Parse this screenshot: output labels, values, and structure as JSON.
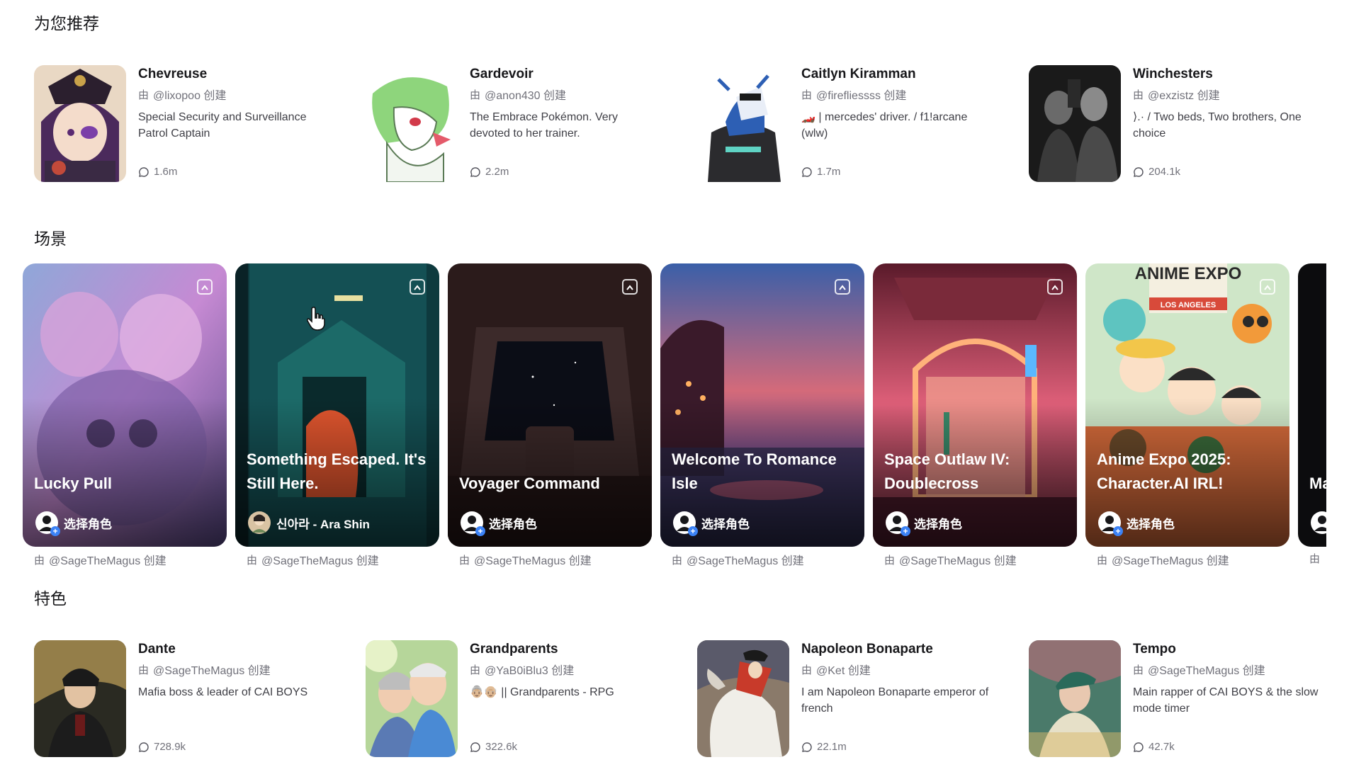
{
  "sections": {
    "recommended": "为您推荐",
    "scenes": "场景",
    "featured": "特色"
  },
  "labels": {
    "creator_glyph": "由",
    "created_suffix": "创建",
    "pick_role": "选择角色"
  },
  "recommended": [
    {
      "name": "Chevreuse",
      "creator": "@lixopoo 创建",
      "desc": "Special Security and Surveillance Patrol Captain",
      "chats": "1.6m"
    },
    {
      "name": "Gardevoir",
      "creator": "@anon430 创建",
      "desc": "The Embrace Pokémon. Very devoted to her trainer.",
      "chats": "2.2m"
    },
    {
      "name": "Caitlyn Kiramman",
      "creator": "@firefliessss 创建",
      "desc": "🏎️ | mercedes' driver. / f1!arcane (wlw)",
      "chats": "1.7m"
    },
    {
      "name": "Winchesters",
      "creator": "@exzistz 创建",
      "desc": "⟩.· / Two beds, Two brothers, One choice",
      "chats": "204.1k"
    }
  ],
  "scenes": [
    {
      "title": "Lucky Pull",
      "pick": "选择角色",
      "by": "@SageTheMagus 创建"
    },
    {
      "title": "Something Escaped. It's Still Here.",
      "pick": "신아라 - Ara Shin",
      "by": "@SageTheMagus 创建"
    },
    {
      "title": "Voyager Command",
      "pick": "选择角色",
      "by": "@SageTheMagus 创建"
    },
    {
      "title": "Welcome To Romance Isle",
      "pick": "选择角色",
      "by": "@SageTheMagus 创建"
    },
    {
      "title": "Space Outlaw IV: Doublecross",
      "pick": "选择角色",
      "by": "@SageTheMagus 创建"
    },
    {
      "title": "Anime Expo 2025: Character.AI IRL!",
      "pick": "选择角色",
      "by": "@SageTheMagus 创建"
    },
    {
      "title": "Ma Sa",
      "pick": "",
      "by": ""
    }
  ],
  "scene_art_text": {
    "anime_expo": "ANIME EXPO",
    "los_angeles": "LOS ANGELES"
  },
  "featured": [
    {
      "name": "Dante",
      "creator": "@SageTheMagus 创建",
      "desc": "Mafia boss & leader of CAI BOYS",
      "chats": "728.9k"
    },
    {
      "name": "Grandparents",
      "creator": "@YaB0iBlu3 创建",
      "desc": "👵🏼👴🏼 || Grandparents - RPG",
      "chats": "322.6k"
    },
    {
      "name": "Napoleon Bonaparte",
      "creator": "@Ket 创建",
      "desc": "I am Napoleon Bonaparte emperor of french",
      "chats": "22.1m"
    },
    {
      "name": "Tempo",
      "creator": "@SageTheMagus 创建",
      "desc": "Main rapper of CAI BOYS & the slow mode timer",
      "chats": "42.7k"
    }
  ],
  "colors": {
    "text_primary": "#18181b",
    "text_secondary": "#71717a",
    "badge_plus": "#3b82f6"
  }
}
